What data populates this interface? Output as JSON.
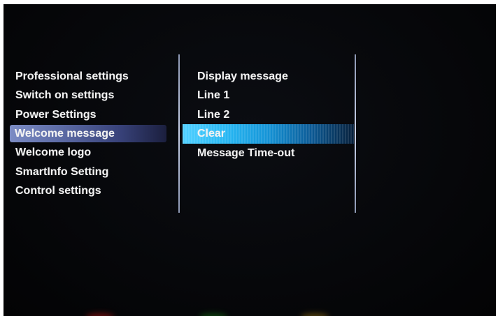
{
  "left_menu": {
    "items": [
      {
        "label": "Professional settings"
      },
      {
        "label": "Switch on settings"
      },
      {
        "label": "Power Settings"
      },
      {
        "label": "Welcome message"
      },
      {
        "label": "Welcome logo"
      },
      {
        "label": "SmartInfo Setting"
      },
      {
        "label": "Control settings"
      }
    ],
    "selected": "Welcome message"
  },
  "right_menu": {
    "items": [
      {
        "label": "Display message"
      },
      {
        "label": "Line 1"
      },
      {
        "label": "Line 2"
      },
      {
        "label": "Clear"
      },
      {
        "label": "Message Time-out"
      }
    ],
    "selected": "Clear"
  },
  "colors": {
    "background": "#06070a",
    "text": "#f2f2f2",
    "left_highlight": "#5f6ea8",
    "right_highlight": "#28b8f4"
  }
}
